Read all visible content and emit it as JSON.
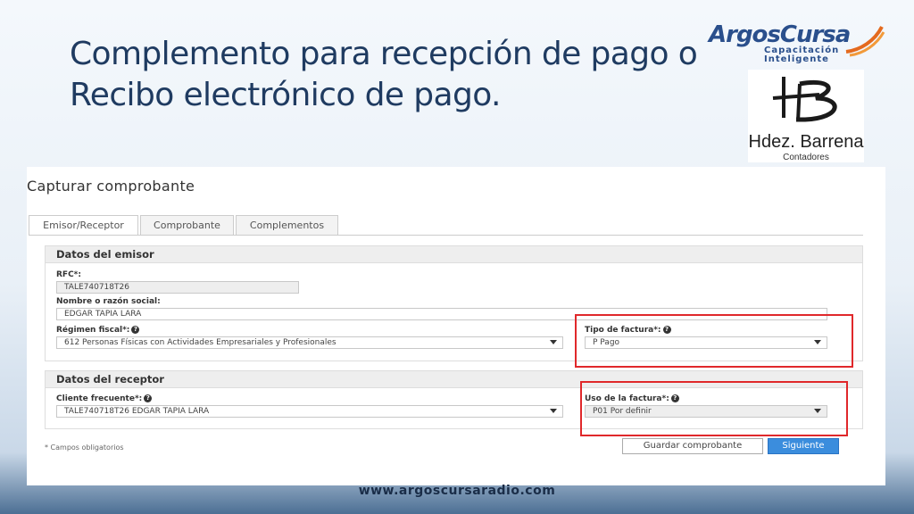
{
  "slide": {
    "title_line1": "Complemento para recepción de pago o",
    "title_line2": "Recibo electrónico de pago.",
    "footer_url": "www.argoscursaradio.com"
  },
  "brand_logo": {
    "name": "ArgosCursa",
    "line1": "Capacitación",
    "line2": "Inteligente"
  },
  "firm_logo": {
    "name": "Hdez. Barrena",
    "subtitle": "Contadores"
  },
  "form": {
    "heading": "Capturar comprobante",
    "tabs": [
      "Emisor/Receptor",
      "Comprobante",
      "Complementos"
    ],
    "active_tab": "Emisor/Receptor",
    "emisor": {
      "section_title": "Datos del emisor",
      "rfc_label": "RFC*:",
      "rfc_value": "TALE740718T26",
      "nombre_label": "Nombre o razón social:",
      "nombre_value": "EDGAR TAPIA LARA",
      "regimen_label": "Régimen fiscal*:",
      "regimen_value": "612 Personas Físicas con Actividades Empresariales y Profesionales",
      "tipo_label": "Tipo de factura*:",
      "tipo_value": "P Pago"
    },
    "receptor": {
      "section_title": "Datos del receptor",
      "cliente_label": "Cliente frecuente*:",
      "cliente_value": "TALE740718T26 EDGAR TAPIA LARA",
      "uso_label": "Uso de la factura*:",
      "uso_value": "P01 Por definir"
    },
    "required_note": "* Campos obligatorios",
    "save_button": "Guardar comprobante",
    "next_button": "Siguiente"
  },
  "colors": {
    "title": "#1f3b61",
    "highlight": "#e0282b",
    "primary_button": "#3b8ddd"
  },
  "icons": {
    "help": "question-circle-icon",
    "dropdown": "caret-down-icon"
  }
}
